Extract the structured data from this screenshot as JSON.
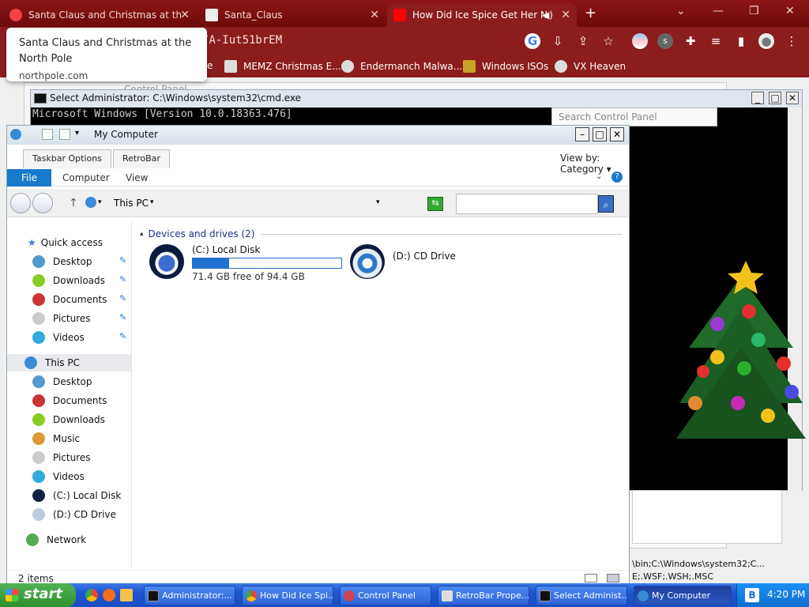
{
  "browser": {
    "tabs": [
      {
        "label": "Santa Claus and Christmas at th",
        "icon": "santa-icon"
      },
      {
        "label": "Santa_Claus",
        "icon": "wiki-icon"
      },
      {
        "label": "How Did Ice Spice Get Her N",
        "icon": "youtube-icon"
      }
    ],
    "url": "/A-Iut51brEM",
    "bookmarks": [
      {
        "label": "MEMZ Christmas E..."
      },
      {
        "label": "Endermanch Malwa..."
      },
      {
        "label": "Windows ISOs"
      },
      {
        "label": "VX Heaven"
      }
    ],
    "bookmark_partial": "e"
  },
  "hovercard": {
    "title": "Santa Claus and Christmas at the North Pole",
    "domain": "northpole.com"
  },
  "controlpanel": {
    "title": "Control Panel",
    "search_placeholder": "Search Control Panel"
  },
  "cmd": {
    "title": "Select Administrator: C:\\Windows\\system32\\cmd.exe",
    "line1": "Microsoft Windows [Version 10.0.18363.476]",
    "path_line1": "\\bin;C:\\Windows\\system32;C...",
    "path_line2": "E;.WSF;.WSH;.MSC"
  },
  "explorer": {
    "title": "My Computer",
    "toolbar_tabs": [
      "Taskbar Options",
      "RetroBar"
    ],
    "viewby_label": "View by:",
    "viewby_value": "Category",
    "ribbon": {
      "file": "File",
      "computer": "Computer",
      "view": "View"
    },
    "address": "This PC",
    "group_title": "Devices and drives (2)",
    "drives": [
      {
        "name": "(C:) Local Disk",
        "free": "71.4 GB free of 94.4 GB",
        "used_fraction": 0.244
      },
      {
        "name": "(D:) CD Drive"
      }
    ],
    "nav": {
      "quick_access": "Quick access",
      "quick_items": [
        "Desktop",
        "Downloads",
        "Documents",
        "Pictures",
        "Videos"
      ],
      "this_pc": "This PC",
      "pc_items": [
        "Desktop",
        "Documents",
        "Downloads",
        "Music",
        "Pictures",
        "Videos",
        "(C:) Local Disk",
        "(D:) CD Drive"
      ],
      "network": "Network"
    },
    "status": "2 items"
  },
  "taskbar": {
    "start": "start",
    "tasks": [
      {
        "label": "Administrator:..."
      },
      {
        "label": "How Did Ice Spi..."
      },
      {
        "label": "Control Panel"
      },
      {
        "label": "RetroBar Prope..."
      },
      {
        "label": "Select Administ..."
      },
      {
        "label": "My Computer"
      }
    ],
    "clock": "4:20 PM"
  }
}
